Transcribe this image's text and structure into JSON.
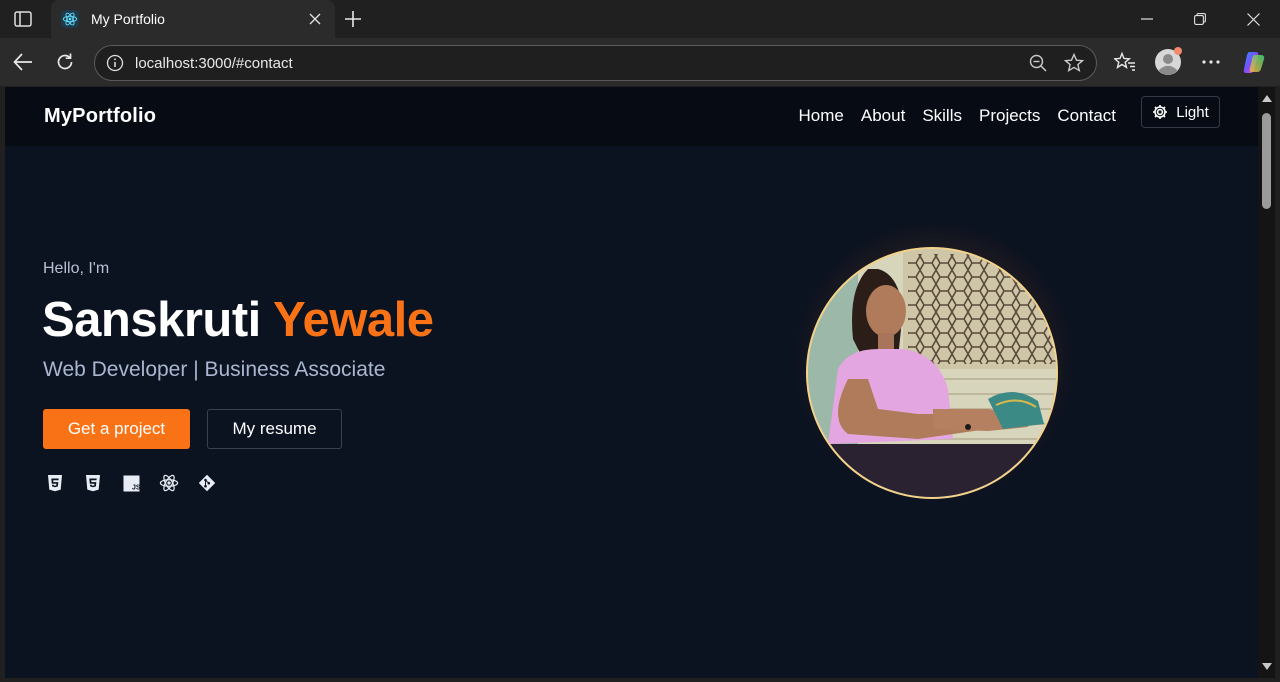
{
  "browser": {
    "tab_title": "My Portfolio",
    "url": "localhost:3000/#contact"
  },
  "site": {
    "brand": "MyPortfolio",
    "nav": [
      "Home",
      "About",
      "Skills",
      "Projects",
      "Contact"
    ],
    "theme_toggle_label": "Light"
  },
  "hero": {
    "greeting": "Hello, I'm",
    "first_name": "Sanskruti",
    "last_name": "Yewale",
    "role": "Web Developer | Business Associate",
    "primary_button": "Get a project",
    "secondary_button": "My resume",
    "tech_icons": [
      "html5-icon",
      "css3-icon",
      "javascript-icon",
      "react-icon",
      "git-icon"
    ]
  },
  "colors": {
    "accent": "#f97316",
    "page_bg": "#0b1220",
    "nav_bg": "#070b14",
    "portrait_ring": "#f3d28a"
  }
}
